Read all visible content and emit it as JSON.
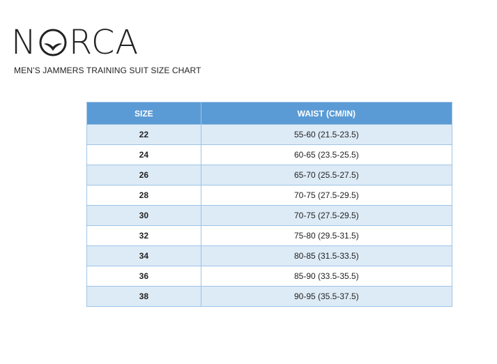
{
  "brand": {
    "letters_before": "N",
    "letters_after": "RCA",
    "logo_color": "#222222"
  },
  "subtitle": "MEN’S JAMMERS TRAINING SUIT SIZE CHART",
  "table": {
    "header_color": "#5b9bd5",
    "stripe_color": "#ddebf7",
    "headers": {
      "size": "SIZE",
      "waist": "WAIST (CM/IN)"
    },
    "rows": [
      {
        "size": "22",
        "waist": "55-60 (21.5-23.5)"
      },
      {
        "size": "24",
        "waist": "60-65 (23.5-25.5)"
      },
      {
        "size": "26",
        "waist": "65-70 (25.5-27.5)"
      },
      {
        "size": "28",
        "waist": "70-75 (27.5-29.5)"
      },
      {
        "size": "30",
        "waist": "70-75 (27.5-29.5)"
      },
      {
        "size": "32",
        "waist": "75-80 (29.5-31.5)"
      },
      {
        "size": "34",
        "waist": "80-85 (31.5-33.5)"
      },
      {
        "size": "36",
        "waist": "85-90 (33.5-35.5)"
      },
      {
        "size": "38",
        "waist": "90-95 (35.5-37.5)"
      }
    ]
  }
}
